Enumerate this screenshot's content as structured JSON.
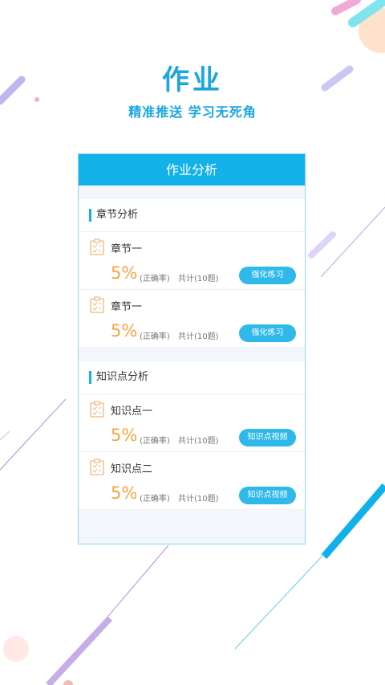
{
  "header": {
    "title": "作业",
    "subtitle": "精准推送 学习无死角"
  },
  "card": {
    "title": "作业分析",
    "sections": [
      {
        "title": "章节分析",
        "items": [
          {
            "name": "章节一",
            "percent": "5%",
            "rate_label": "(正确率)",
            "total": "共计(10题)",
            "button": "强化练习"
          },
          {
            "name": "章节一",
            "percent": "5%",
            "rate_label": "(正确率)",
            "total": "共计(10题)",
            "button": "强化练习"
          }
        ]
      },
      {
        "title": "知识点分析",
        "items": [
          {
            "name": "知识点一",
            "percent": "5%",
            "rate_label": "(正确率)",
            "total": "共计(10题)",
            "button": "知识点视频"
          },
          {
            "name": "知识点二",
            "percent": "5%",
            "rate_label": "(正确率)",
            "total": "共计(10题)",
            "button": "知识点视频"
          }
        ]
      }
    ]
  },
  "colors": {
    "primary": "#12b1ea",
    "accent_orange": "#f5a543",
    "text": "#333333"
  }
}
